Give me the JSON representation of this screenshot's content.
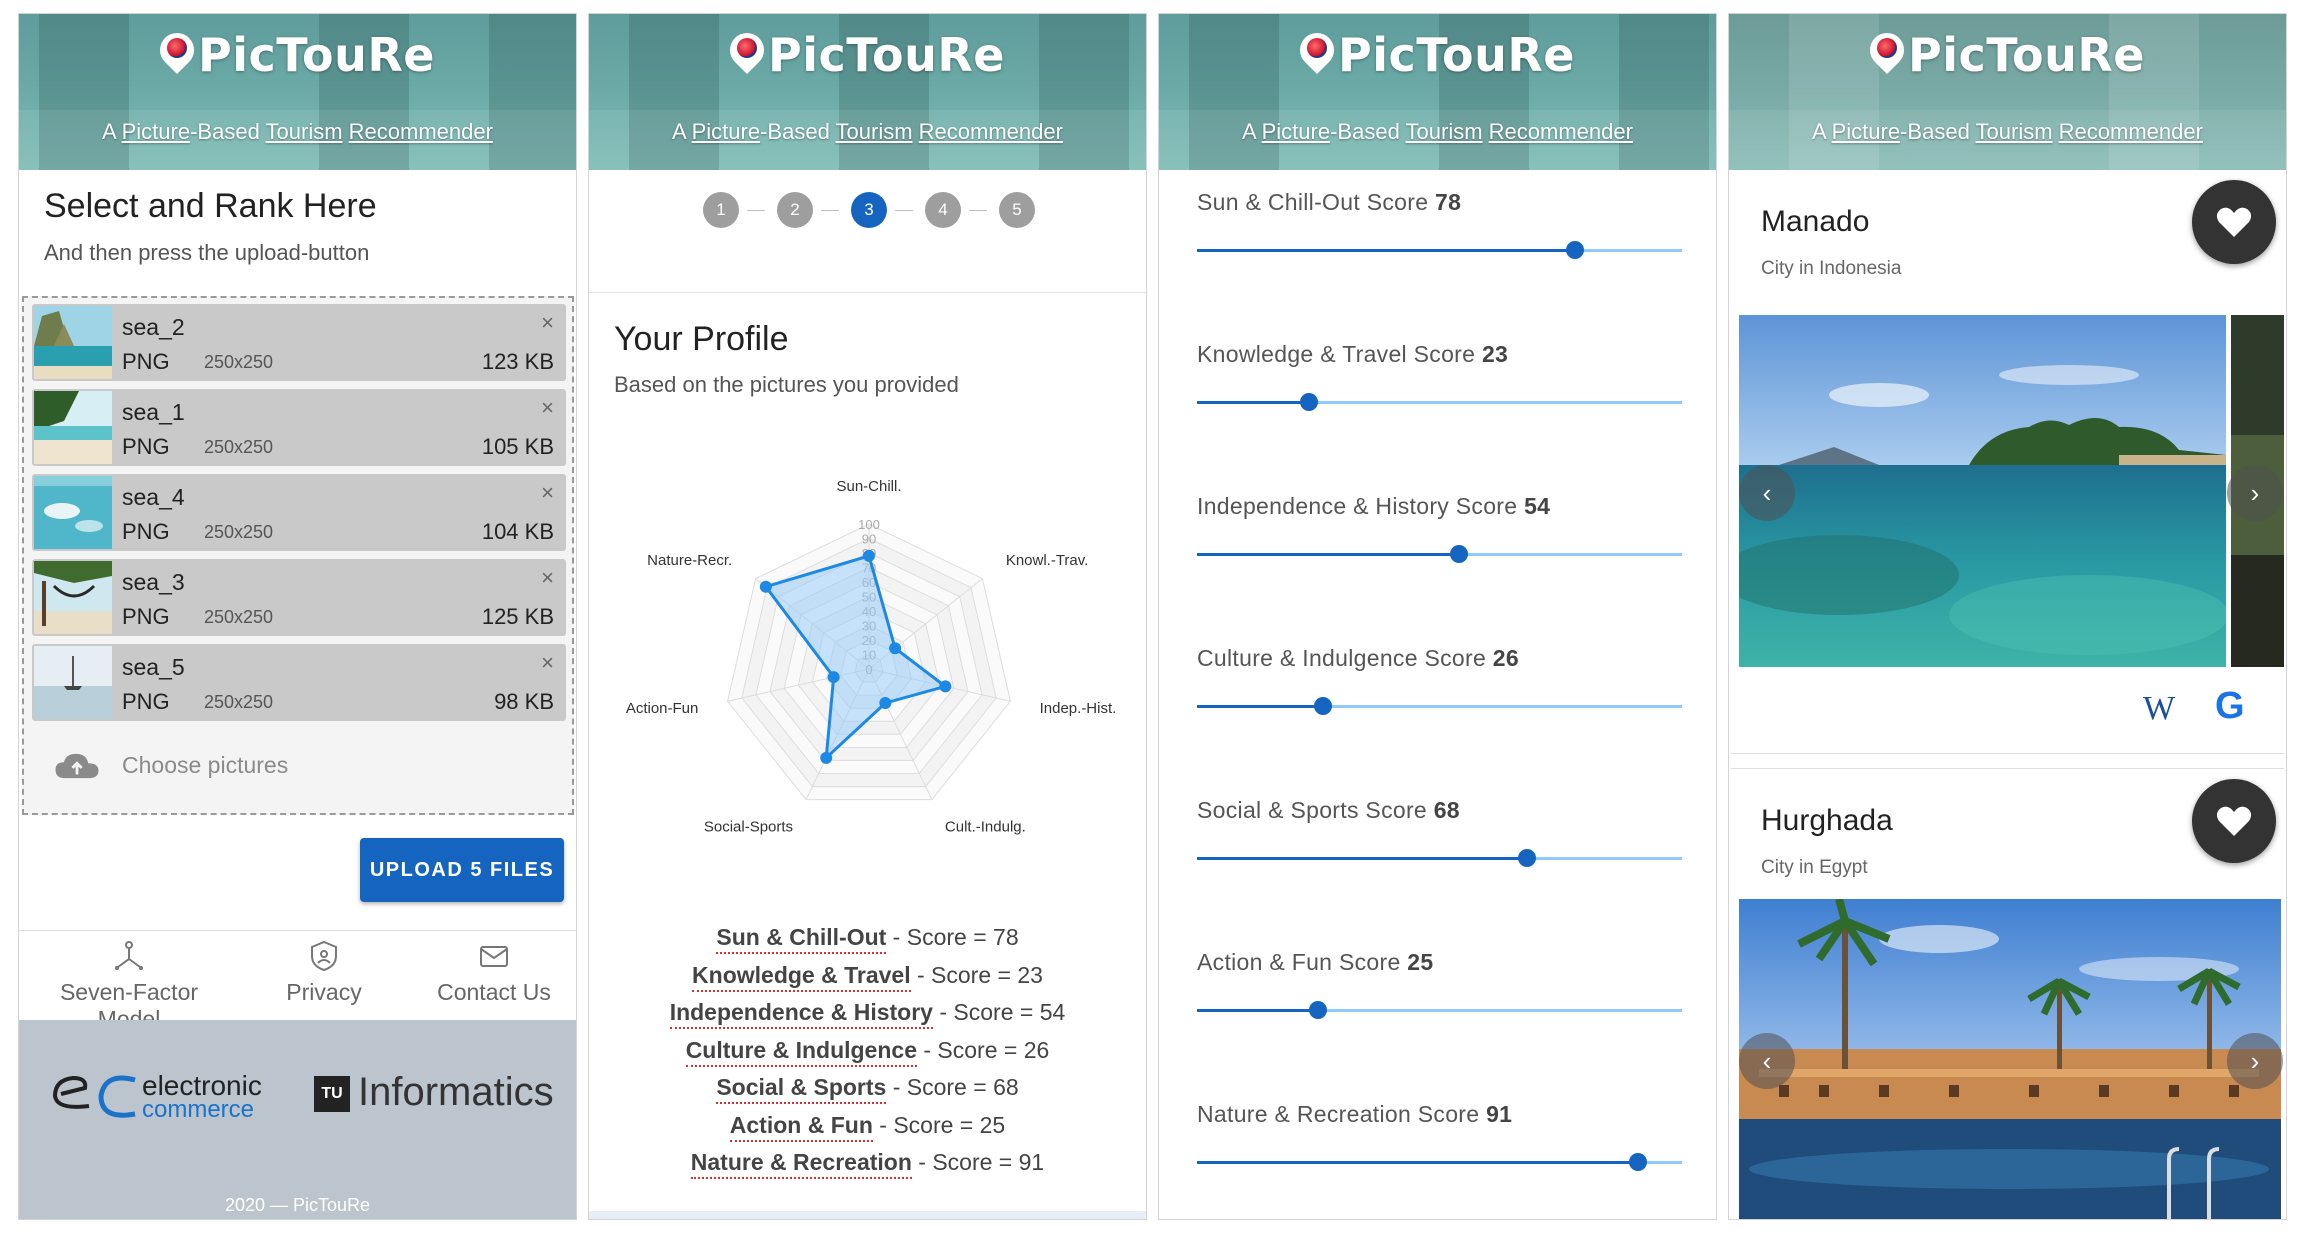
{
  "brand": {
    "name": "PicTouRe",
    "tagline_parts": [
      "A ",
      "Picture",
      "-Based ",
      "Tourism",
      " ",
      "Recommender"
    ]
  },
  "upload_screen": {
    "title": "Select and Rank Here",
    "subtitle": "And then press the upload-button",
    "files": [
      {
        "name": "sea_2",
        "type": "PNG",
        "dims": "250x250",
        "size": "123 KB"
      },
      {
        "name": "sea_1",
        "type": "PNG",
        "dims": "250x250",
        "size": "105 KB"
      },
      {
        "name": "sea_4",
        "type": "PNG",
        "dims": "250x250",
        "size": "104 KB"
      },
      {
        "name": "sea_3",
        "type": "PNG",
        "dims": "250x250",
        "size": "125 KB"
      },
      {
        "name": "sea_5",
        "type": "PNG",
        "dims": "250x250",
        "size": "98 KB"
      }
    ],
    "close_glyph": "×",
    "choose_label": "Choose pictures",
    "upload_button": "UPLOAD 5 FILES",
    "nav": [
      {
        "label": "Seven-Factor Model",
        "icon": "network-icon"
      },
      {
        "label": "Privacy",
        "icon": "shield-icon"
      },
      {
        "label": "Contact Us",
        "icon": "mail-icon"
      }
    ],
    "footer": {
      "ec_logo_text_1": "electronic",
      "ec_logo_text_2": "commerce",
      "tu_logo_text": "Informatics",
      "copyright": "2020 — PicTouRe"
    }
  },
  "profile_screen": {
    "steps": [
      "1",
      "2",
      "3",
      "4",
      "5"
    ],
    "active_step": 3,
    "title": "Your Profile",
    "subtitle": "Based on the pictures you provided",
    "scores_text": [
      {
        "name": "Sun & Chill-Out",
        "rest": " - Score = 78"
      },
      {
        "name": "Knowledge & Travel",
        "rest": " - Score = 23"
      },
      {
        "name": "Independence & History",
        "rest": " - Score = 54"
      },
      {
        "name": "Culture & Indulgence",
        "rest": " - Score = 26"
      },
      {
        "name": "Social & Sports",
        "rest": " - Score = 68"
      },
      {
        "name": "Action & Fun",
        "rest": " - Score = 25"
      },
      {
        "name": "Nature & Recreation",
        "rest": " - Score = 91"
      }
    ]
  },
  "chart_data": {
    "type": "radar",
    "axes": [
      "Sun-Chill.",
      "Knowl.-Trav.",
      "Indep.-Hist.",
      "Cult.-Indulg.",
      "Social-Sports",
      "Action-Fun",
      "Nature-Recr."
    ],
    "values": [
      78,
      23,
      54,
      26,
      68,
      25,
      91
    ],
    "rlim": [
      0,
      100
    ],
    "ticks": [
      "0",
      "10",
      "20",
      "30",
      "40",
      "50",
      "60",
      "70",
      "80",
      "90",
      "100"
    ],
    "fill_color": "#90caf9",
    "line_color": "#1e88e5"
  },
  "sliders_screen": {
    "sliders": [
      {
        "label": "Sun & Chill-Out Score",
        "value": 78
      },
      {
        "label": "Knowledge & Travel Score",
        "value": 23
      },
      {
        "label": "Independence & History Score",
        "value": 54
      },
      {
        "label": "Culture & Indulgence Score",
        "value": 26
      },
      {
        "label": "Social & Sports Score",
        "value": 68
      },
      {
        "label": "Action & Fun Score",
        "value": 25
      },
      {
        "label": "Nature & Recreation Score",
        "value": 91
      }
    ]
  },
  "results_screen": {
    "cards": [
      {
        "name": "Manado",
        "subtitle": "City in Indonesia",
        "wiki_label": "W",
        "google_label": "G"
      },
      {
        "name": "Hurghada",
        "subtitle": "City in Egypt"
      }
    ],
    "prev_glyph": "‹",
    "next_glyph": "›"
  },
  "colors": {
    "accent": "#1565c0",
    "header": "#6aa9a6",
    "footer": "#bcc5cd",
    "favorite_button": "#333333"
  }
}
